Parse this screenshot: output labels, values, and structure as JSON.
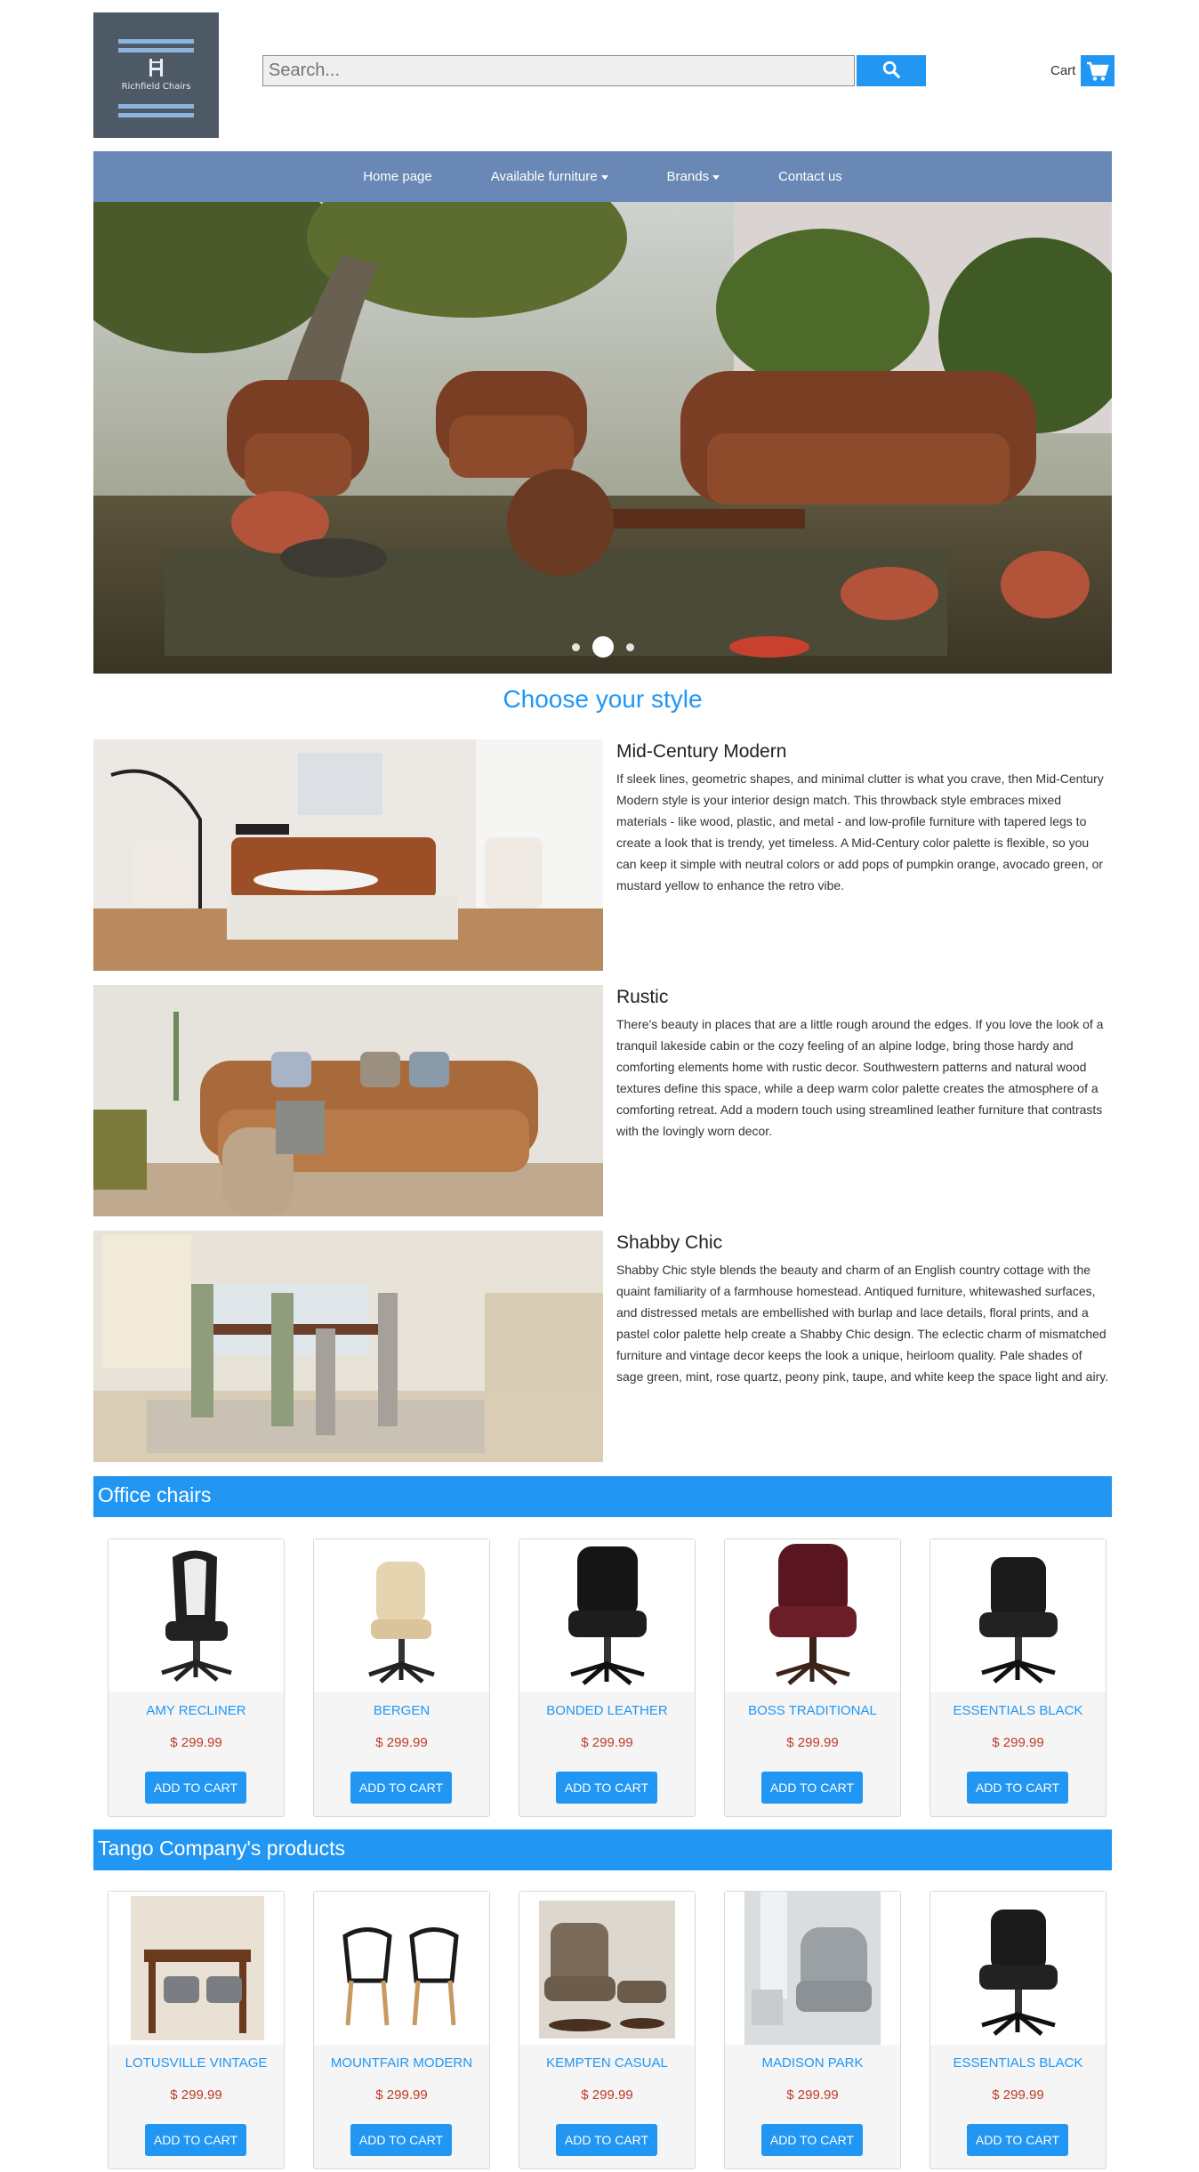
{
  "brand": {
    "logo_text": "Richfield Chairs"
  },
  "search": {
    "placeholder": "Search..."
  },
  "cart": {
    "label": "Cart"
  },
  "nav": {
    "items": [
      {
        "label": "Home page",
        "dropdown": false
      },
      {
        "label": "Available furniture",
        "dropdown": true
      },
      {
        "label": "Brands",
        "dropdown": true
      },
      {
        "label": "Contact us",
        "dropdown": false
      }
    ]
  },
  "hero": {
    "slides": 3,
    "active_slide": 2
  },
  "styles_section": {
    "title": "Choose your style",
    "items": [
      {
        "title": "Mid-Century Modern",
        "description": "If sleek lines, geometric shapes, and minimal clutter is what you crave, then Mid-Century Modern style is your interior design match. This throwback style embraces mixed materials - like wood, plastic, and metal - and low-profile furniture with tapered legs to create a look that is trendy, yet timeless. A Mid-Century color palette is flexible, so you can keep it simple with neutral colors or add pops of pumpkin orange, avocado green, or mustard yellow to enhance the retro vibe."
      },
      {
        "title": "Rustic",
        "description": "There's beauty in places that are a little rough around the edges. If you love the look of a tranquil lakeside cabin or the cozy feeling of an alpine lodge, bring those hardy and comforting elements home with rustic decor. Southwestern patterns and natural wood textures define this space, while a deep warm color palette creates the atmosphere of a comforting retreat. Add a modern touch using streamlined leather furniture that contrasts with the lovingly worn decor."
      },
      {
        "title": "Shabby Chic",
        "description": "Shabby Chic style blends the beauty and charm of an English country cottage with the quaint familiarity of a farmhouse homestead. Antiqued furniture, whitewashed surfaces, and distressed metals are embellished with burlap and lace details, floral prints, and a pastel color palette help create a Shabby Chic design. The eclectic charm of mismatched furniture and vintage decor keeps the look a unique, heirloom quality. Pale shades of sage green, mint, rose quartz, peony pink, taupe, and white keep the space light and airy."
      }
    ]
  },
  "office_chairs": {
    "title": "Office chairs",
    "button_label": "ADD TO CART",
    "products": [
      {
        "name": "AMY RECLINER",
        "price": "$ 299.99"
      },
      {
        "name": "BERGEN",
        "price": "$ 299.99"
      },
      {
        "name": "BONDED LEATHER",
        "price": "$ 299.99"
      },
      {
        "name": "BOSS TRADITIONAL",
        "price": "$ 299.99"
      },
      {
        "name": "ESSENTIALS BLACK",
        "price": "$ 299.99"
      }
    ]
  },
  "tango": {
    "title": "Tango Company's products",
    "button_label": "ADD TO CART",
    "products": [
      {
        "name": "LOTUSVILLE VINTAGE",
        "price": "$ 299.99"
      },
      {
        "name": "MOUNTFAIR MODERN",
        "price": "$ 299.99"
      },
      {
        "name": "KEMPTEN CASUAL",
        "price": "$ 299.99"
      },
      {
        "name": "MADISON PARK",
        "price": "$ 299.99"
      },
      {
        "name": "ESSENTIALS BLACK",
        "price": "$ 299.99"
      }
    ]
  },
  "colors": {
    "accent": "#2196f3",
    "nav": "#6a88b5",
    "price": "#c0392b",
    "logo_bg": "#4d5964"
  },
  "icons": {
    "search": "search-icon",
    "cart": "cart-icon",
    "prev": "chevron-left-icon",
    "next": "chevron-right-icon"
  }
}
